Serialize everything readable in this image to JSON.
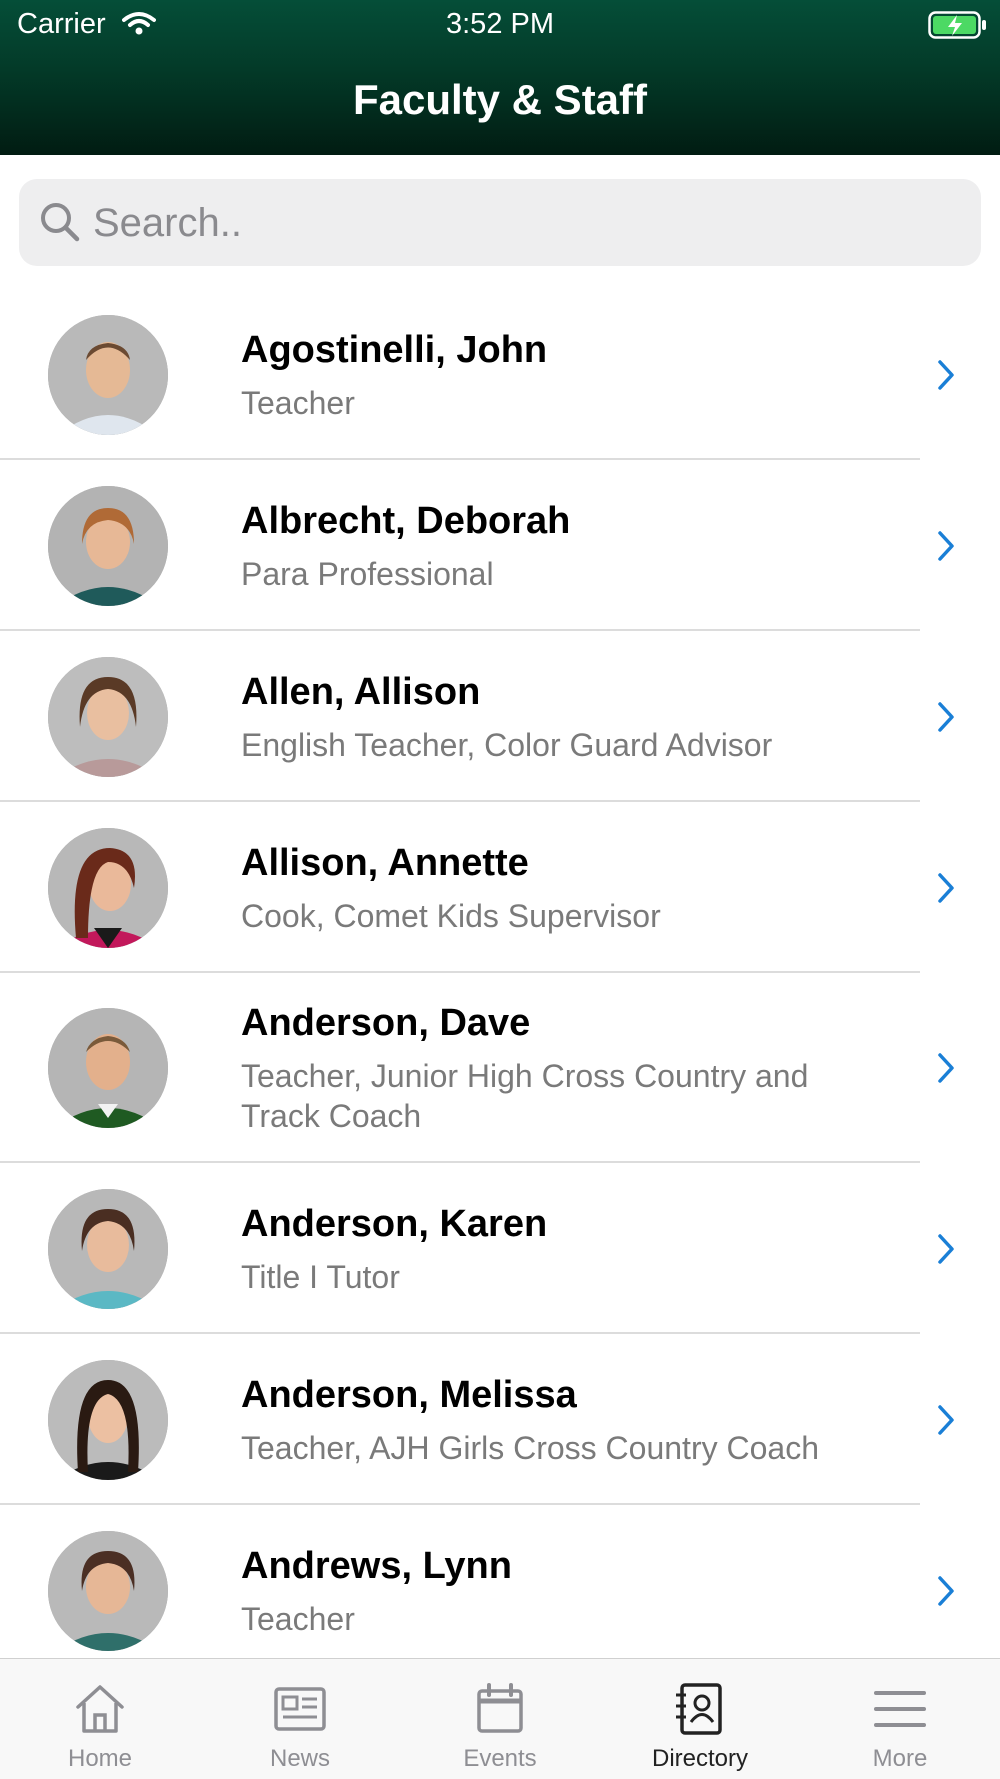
{
  "status_bar": {
    "carrier": "Carrier",
    "time": "3:52 PM"
  },
  "header": {
    "title": "Faculty & Staff"
  },
  "search": {
    "placeholder": "Search.."
  },
  "staff": [
    {
      "name": "Agostinelli, John",
      "role": "Teacher"
    },
    {
      "name": "Albrecht, Deborah",
      "role": "Para Professional"
    },
    {
      "name": "Allen, Allison",
      "role": "English Teacher, Color Guard Advisor"
    },
    {
      "name": "Allison, Annette",
      "role": "Cook, Comet Kids Supervisor"
    },
    {
      "name": "Anderson, Dave",
      "role": "Teacher, Junior High Cross Country and Track Coach"
    },
    {
      "name": "Anderson, Karen",
      "role": "Title I Tutor"
    },
    {
      "name": "Anderson, Melissa",
      "role": "Teacher, AJH Girls Cross Country Coach"
    },
    {
      "name": "Andrews, Lynn",
      "role": "Teacher"
    }
  ],
  "tabbar": {
    "home": "Home",
    "news": "News",
    "events": "Events",
    "directory": "Directory",
    "more": "More",
    "active": "directory"
  },
  "colors": {
    "header_green": "#054e38",
    "accent_blue": "#1a7fd6",
    "battery_green": "#4cd964"
  },
  "icons": [
    "wifi-icon",
    "battery-charging-icon",
    "search-icon",
    "chevron-right-icon",
    "home-icon",
    "news-icon",
    "events-icon",
    "directory-icon",
    "more-icon"
  ]
}
